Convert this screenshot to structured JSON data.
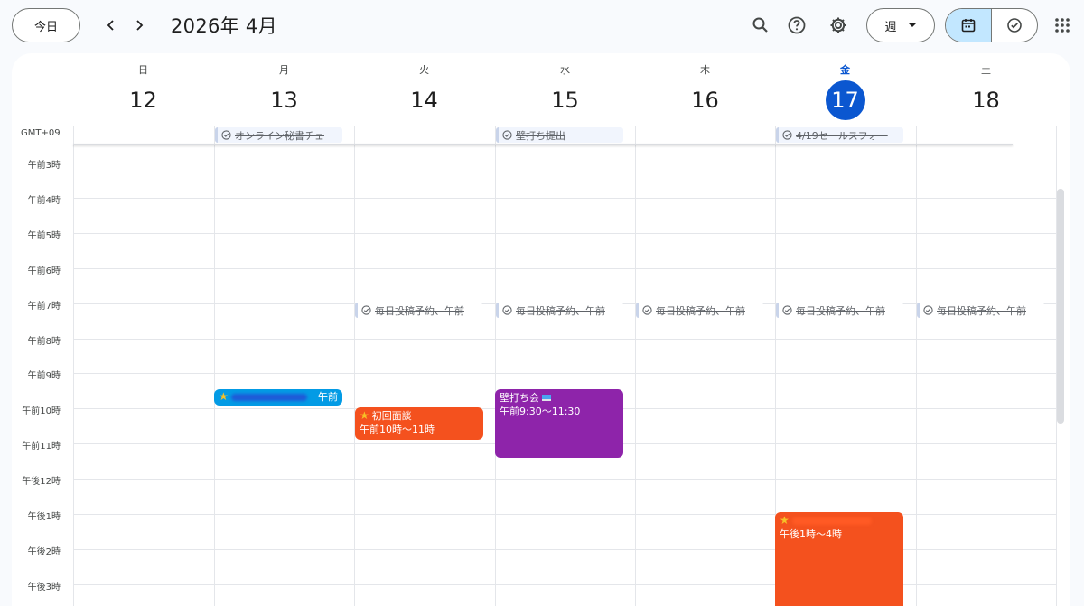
{
  "toolbar": {
    "today_label": "今日",
    "month_title": "2026年 4月",
    "view_label": "週",
    "icons": [
      "chevron-left-icon",
      "chevron-right-icon",
      "search-icon",
      "help-icon",
      "settings-icon",
      "calendar-view-icon",
      "tasks-view-icon",
      "apps-grid-icon"
    ]
  },
  "calendar": {
    "timezone": "GMT+09",
    "days": [
      {
        "name": "日",
        "num": "12"
      },
      {
        "name": "月",
        "num": "13"
      },
      {
        "name": "火",
        "num": "14"
      },
      {
        "name": "水",
        "num": "15"
      },
      {
        "name": "木",
        "num": "16"
      },
      {
        "name": "金",
        "num": "17",
        "today": true
      },
      {
        "name": "土",
        "num": "18"
      }
    ],
    "hours": [
      "午前3時",
      "午前4時",
      "午前5時",
      "午前6時",
      "午前7時",
      "午前8時",
      "午前9時",
      "午前10時",
      "午前11時",
      "午後12時",
      "午後1時",
      "午後2時",
      "午後3時"
    ],
    "allday_tasks": {
      "mon": "オンライン秘書チェ",
      "wed": "壁打ち提出",
      "fri": "4/19セールスフォー"
    },
    "daily_task": "毎日投稿予約",
    "daily_task_suffix": "、午前",
    "events": {
      "mon": {
        "trailing": "午前"
      },
      "tue": {
        "title": "初回面談",
        "time": "午前10時～11時"
      },
      "wed": {
        "title": "壁打ち会",
        "time": "午前9:30～11:30"
      },
      "fri": {
        "time": "午後1時～4時"
      }
    },
    "colors": {
      "accent": "#0b57d0",
      "peacock": "#039be5",
      "tangerine": "#f4511e",
      "grape": "#8e24aa"
    }
  }
}
